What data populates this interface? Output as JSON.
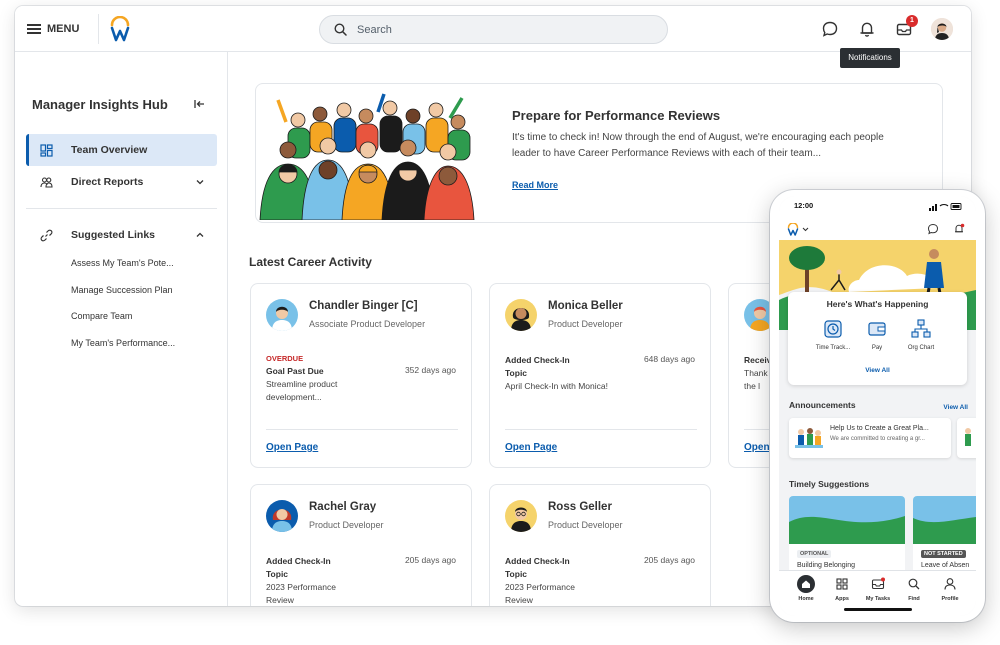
{
  "topbar": {
    "menu_label": "MENU",
    "search_placeholder": "Search",
    "notification_count": "1",
    "tooltip": "Notifications"
  },
  "sidebar": {
    "title": "Manager Insights Hub",
    "items": [
      {
        "label": "Team Overview",
        "icon": "dashboard-icon",
        "active": true
      },
      {
        "label": "Direct Reports",
        "icon": "people-icon"
      },
      {
        "label": "Suggested Links",
        "icon": "link-icon"
      }
    ],
    "links": [
      "Assess My Team's Pote...",
      "Manage Succession Plan",
      "Compare Team",
      "My Team's Performance..."
    ]
  },
  "promo": {
    "title": "Prepare for Performance Reviews",
    "body": "It's time to check in! Now through the end of August, we're encouraging each people leader to have Career Performance Reviews with each of their team...",
    "link": "Read More"
  },
  "activity": {
    "title": "Latest Career Activity",
    "cards": [
      {
        "name": "Chandler Binger [C]",
        "role": "Associate Product Developer",
        "tag": "OVERDUE",
        "label": "Goal Past Due",
        "ago": "352 days ago",
        "desc": "Streamline product development...",
        "link": "Open Page"
      },
      {
        "name": "Monica Beller",
        "role": "Product Developer",
        "label": "Added Check-In Topic",
        "ago": "648 days ago",
        "desc": "April Check-In with Monica!",
        "link": "Open Page"
      },
      {
        "label": "Receiv",
        "desc": "Thank all the l",
        "link": "Open"
      },
      {
        "name": "Rachel Gray",
        "role": "Product Developer",
        "label": "Added Check-In Topic",
        "ago": "205 days ago",
        "desc": "2023 Performance Review"
      },
      {
        "name": "Ross Geller",
        "role": "Product Developer",
        "label": "Added Check-In Topic",
        "ago": "205 days ago",
        "desc": "2023 Performance Review"
      }
    ]
  },
  "phone": {
    "time": "12:00",
    "happening_title": "Here's What's Happening",
    "apps": [
      "Time Track...",
      "Pay",
      "Org Chart"
    ],
    "view_all": "View All",
    "announcements_title": "Announcements",
    "announcements_view_all": "View All",
    "announcement_title": "Help Us to Create a Great Pla...",
    "announcement_sub": "We are committed to creating a gr...",
    "suggestions_title": "Timely Suggestions",
    "suggestions": [
      {
        "status": "OPTIONAL",
        "name": "Building Belonging"
      },
      {
        "status": "NOT STARTED",
        "name": "Leave of Absen"
      }
    ],
    "nav": [
      "Home",
      "Apps",
      "My Tasks",
      "Find",
      "Profile"
    ]
  },
  "colors": {
    "accent": "#0b5cad",
    "active_bg": "#dce8f7",
    "overdue": "#c62828",
    "badge": "#d92b2b"
  }
}
